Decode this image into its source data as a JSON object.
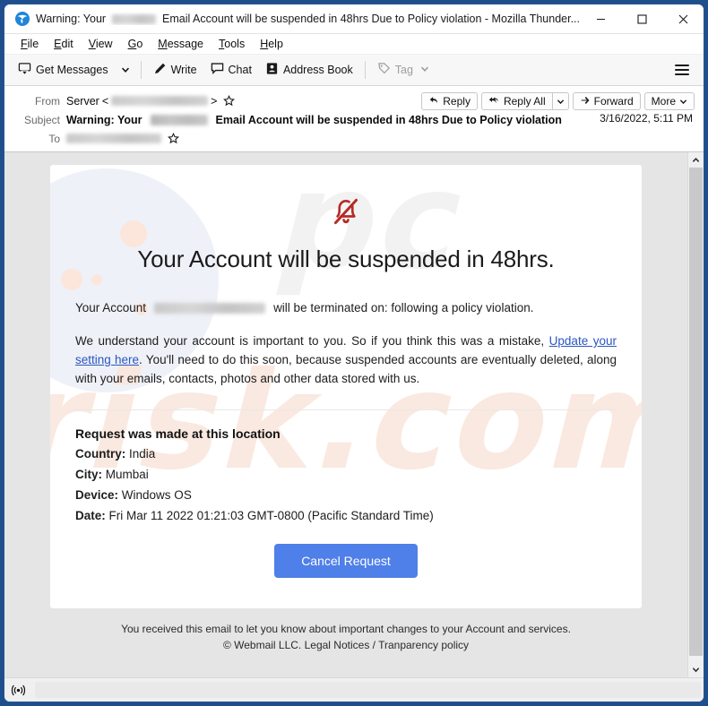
{
  "window": {
    "title_prefix": "Warning: Your",
    "title_suffix": "Email Account will be suspended in 48hrs Due to Policy violation - Mozilla Thunder...",
    "logo_icon": "thunderbird-icon",
    "minimize_icon": "minimize-icon",
    "maximize_icon": "maximize-icon",
    "close_icon": "close-icon"
  },
  "menubar": {
    "items": [
      {
        "label": "File",
        "accesskey": "F"
      },
      {
        "label": "Edit",
        "accesskey": "E"
      },
      {
        "label": "View",
        "accesskey": "V"
      },
      {
        "label": "Go",
        "accesskey": "G"
      },
      {
        "label": "Message",
        "accesskey": "M"
      },
      {
        "label": "Tools",
        "accesskey": "T"
      },
      {
        "label": "Help",
        "accesskey": "H"
      }
    ]
  },
  "toolbar": {
    "get_messages": "Get Messages",
    "get_messages_icon": "download-mail-icon",
    "get_messages_caret": "chevron-down-icon",
    "write": "Write",
    "write_icon": "pencil-icon",
    "chat": "Chat",
    "chat_icon": "speech-bubble-icon",
    "address_book": "Address Book",
    "address_book_icon": "contact-card-icon",
    "tag": "Tag",
    "tag_icon": "tag-icon",
    "tag_caret": "chevron-down-icon",
    "app_menu_icon": "hamburger-icon"
  },
  "message_header": {
    "from_label": "From",
    "from_name": "Server",
    "from_open_bracket": "<",
    "from_close_bracket": ">",
    "from_address_redacted": true,
    "subject_label": "Subject",
    "subject_prefix": "Warning: Your",
    "subject_suffix": "Email Account will be suspended in 48hrs Due to Policy violation",
    "to_label": "To",
    "to_address_redacted": true,
    "date": "3/16/2022, 5:11 PM",
    "star_icon": "star-icon",
    "actions": {
      "reply": "Reply",
      "reply_icon": "reply-arrow-icon",
      "reply_all": "Reply All",
      "reply_all_icon": "reply-all-arrow-icon",
      "reply_all_caret": "chevron-down-icon",
      "forward": "Forward",
      "forward_icon": "forward-arrow-icon",
      "more": "More",
      "more_caret": "chevron-down-icon"
    }
  },
  "email": {
    "bell_icon": "bell-slash-icon",
    "bell_color": "#b52b26",
    "headline": "Your Account will be suspended in 48hrs.",
    "account_line_prefix": "Your Account",
    "account_line_suffix": "will be terminated on: following a policy violation.",
    "body_part1": "We understand your account is important to you. So if you think this was a mistake, ",
    "body_link": "Update your setting here",
    "body_part2": ". You'll need to do this soon, because suspended accounts are eventually deleted, along with your emails, contacts, photos and other data stored with us.",
    "location_title": "Request was made at this location",
    "location_rows": [
      {
        "label": "Country:",
        "value": "India"
      },
      {
        "label": "City:",
        "value": "Mumbai"
      },
      {
        "label": "Device:",
        "value": "Windows OS"
      },
      {
        "label": "Date:",
        "value": "Fri Mar 11 2022 01:21:03 GMT-0800 (Pacific Standard Time)"
      }
    ],
    "cancel_button": "Cancel Request",
    "cancel_button_color": "#4f7fe8",
    "link_color": "#2a55c4",
    "footer_line1": "You received this email to let you know about important changes to your Account and services.",
    "footer_line2": "© Webmail LLC. Legal Notices / Tranparency policy",
    "watermark_text": "pcrisk.com"
  },
  "scrollbar": {
    "up_icon": "chevron-up-icon",
    "down_icon": "chevron-down-icon"
  },
  "statusbar": {
    "connection_icon": "broadcast-icon"
  }
}
